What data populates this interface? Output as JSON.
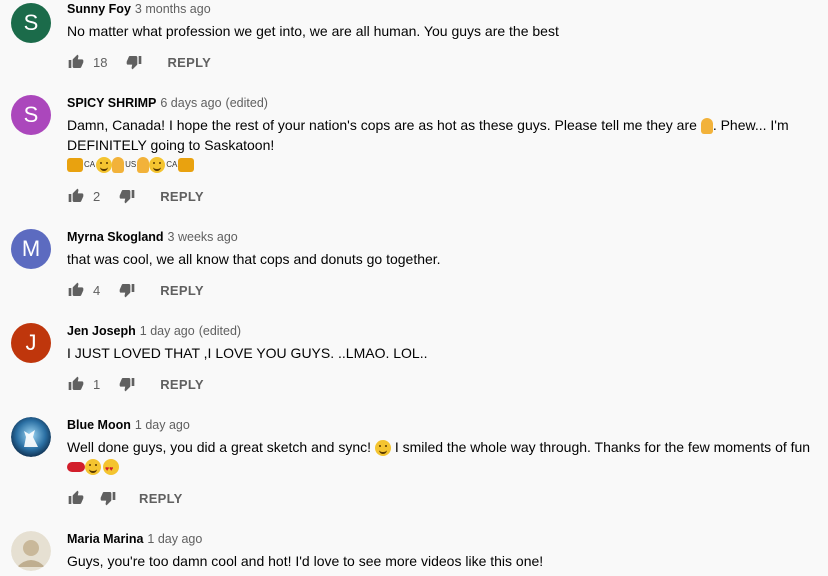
{
  "comments": [
    {
      "avatar_letter": "S",
      "avatar_color": "#1b6b4a",
      "author": "Sunny Foy",
      "time": "3 months ago",
      "edited": "",
      "lines": [
        "No matter what profession we get into, we are all human. You guys are the best"
      ],
      "likes": "18",
      "reply": "REPLY"
    },
    {
      "avatar_letter": "S",
      "avatar_color": "#ab47bc",
      "author": "SPICY SHRIMP",
      "time": "6 days ago",
      "edited": "(edited)",
      "lines": [
        "Damn, Canada! I hope the rest of your nation's cops are as hot as these guys. Please tell me they are",
        ". Phew... I'm",
        "DEFINITELY going to Saskatoon!"
      ],
      "flags": [
        "CA",
        "US",
        "CA"
      ],
      "likes": "2",
      "reply": "REPLY"
    },
    {
      "avatar_letter": "M",
      "avatar_color": "#5c6bc0",
      "author": "Myrna Skogland",
      "time": "3 weeks ago",
      "edited": "",
      "lines": [
        "that was cool,  we all know that cops and donuts go together."
      ],
      "likes": "4",
      "reply": "REPLY"
    },
    {
      "avatar_letter": "J",
      "avatar_color": "#bf360c",
      "author": "Jen Joseph",
      "time": "1 day ago",
      "edited": "(edited)",
      "lines": [
        "I JUST LOVED THAT ,I LOVE YOU GUYS. ..LMAO. LOL.."
      ],
      "likes": "1",
      "reply": "REPLY"
    },
    {
      "avatar_letter": "",
      "avatar_color": "#0d2b4a",
      "author": "Blue Moon",
      "time": "1 day ago",
      "edited": "",
      "lines": [
        "Well done guys, you did a great sketch and sync!",
        "I smiled the whole way through. Thanks for the few moments of fun"
      ],
      "likes": "",
      "reply": "REPLY"
    },
    {
      "avatar_letter": "",
      "avatar_color": "#d8d2c4",
      "author": "Maria Marina",
      "time": "1 day ago",
      "edited": "",
      "lines": [
        "Guys, you're too damn cool and hot! I'd love to see more videos like this one!"
      ],
      "likes": "",
      "reply": ""
    }
  ]
}
